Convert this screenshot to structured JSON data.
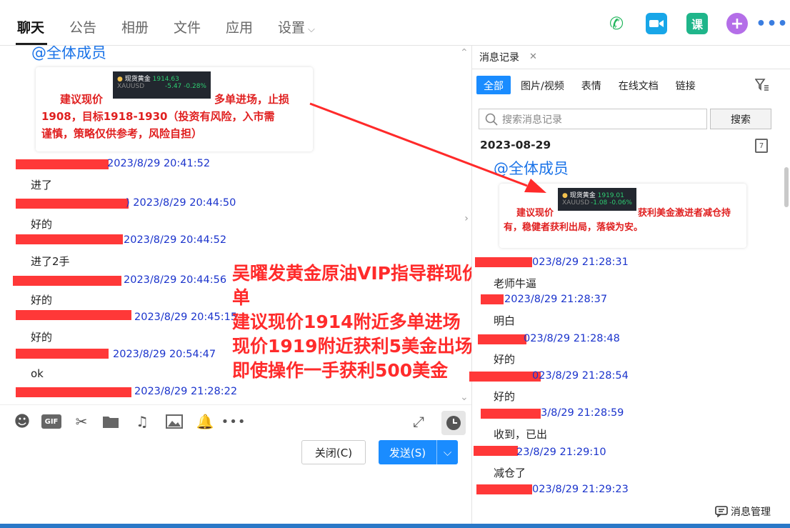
{
  "tabs": [
    {
      "label": "聊天",
      "active": true
    },
    {
      "label": "公告"
    },
    {
      "label": "相册"
    },
    {
      "label": "文件"
    },
    {
      "label": "应用"
    },
    {
      "label": "设置"
    }
  ],
  "header_icons": [
    "phone-icon",
    "video-icon",
    "course-icon",
    "add-icon",
    "more-icon"
  ],
  "course_label": "课",
  "left": {
    "at_all": "@全体成员",
    "card": {
      "tag_name": "现货黄金",
      "tag_code": "XAUUSD",
      "tag_price": "1914.63",
      "tag_change": "-5.47 -0.28%",
      "text_a": "建议现价",
      "text_b": "多单进场，止损",
      "text_c": "1908，目标1918-1930（投资有风险，入市需",
      "text_d": "谨慎，策略仅供参考，风险自担）"
    },
    "messages": [
      {
        "time": "2023/8/29 20:41:52",
        "text": "进了"
      },
      {
        "time": ") 2023/8/29 20:44:50",
        "text": "好的"
      },
      {
        "time": "2023/8/29 20:44:52",
        "text": "进了2手"
      },
      {
        "time": "2023/8/29 20:44:56",
        "text": "好的"
      },
      {
        "time": "2023/8/29 20:45:15",
        "text": "好的"
      },
      {
        "time": "2023/8/29 20:54:47",
        "text": "ok"
      },
      {
        "time": "2023/8/29 21:28:22",
        "text": ""
      }
    ],
    "overlay_lines": [
      "吴曜发黄金原油VIP指导群现价单",
      "建议现价1914附近多单进场",
      "现价1919附近获利5美金出场",
      "即使操作一手获利500美金"
    ],
    "close_btn": "关闭(C)",
    "send_btn": "发送(S)"
  },
  "right": {
    "tab_title": "消息记录",
    "filters": [
      "全部",
      "图片/视频",
      "表情",
      "在线文档",
      "链接"
    ],
    "search_placeholder": "搜索消息记录",
    "search_btn": "搜索",
    "date": "2023-08-29",
    "cal_day": "7",
    "at_all": "@全体成员",
    "card": {
      "tag_name": "现货黄金",
      "tag_code": "XAUUSD",
      "tag_price": "1919.01",
      "tag_change": "-1.08 -0.06%",
      "text_a": "建议现价",
      "text_b": "获利美金激进者减仓持",
      "text_c": "有，稳健者获利出局，落袋为安。"
    },
    "messages": [
      {
        "time": "023/8/29 21:28:31",
        "text": "老师牛逼"
      },
      {
        "time": "2023/8/29 21:28:37",
        "text": "明白"
      },
      {
        "time": "023/8/29 21:28:48",
        "text": "好的"
      },
      {
        "time": "023/8/29 21:28:54",
        "text": "好的"
      },
      {
        "time": "3/8/29 21:28:59",
        "text": "收到，已出"
      },
      {
        "time": "23/8/29 21:29:10",
        "text": "减仓了"
      },
      {
        "time": "023/8/29 21:29:23",
        "text": ""
      }
    ],
    "manager": "消息管理"
  }
}
